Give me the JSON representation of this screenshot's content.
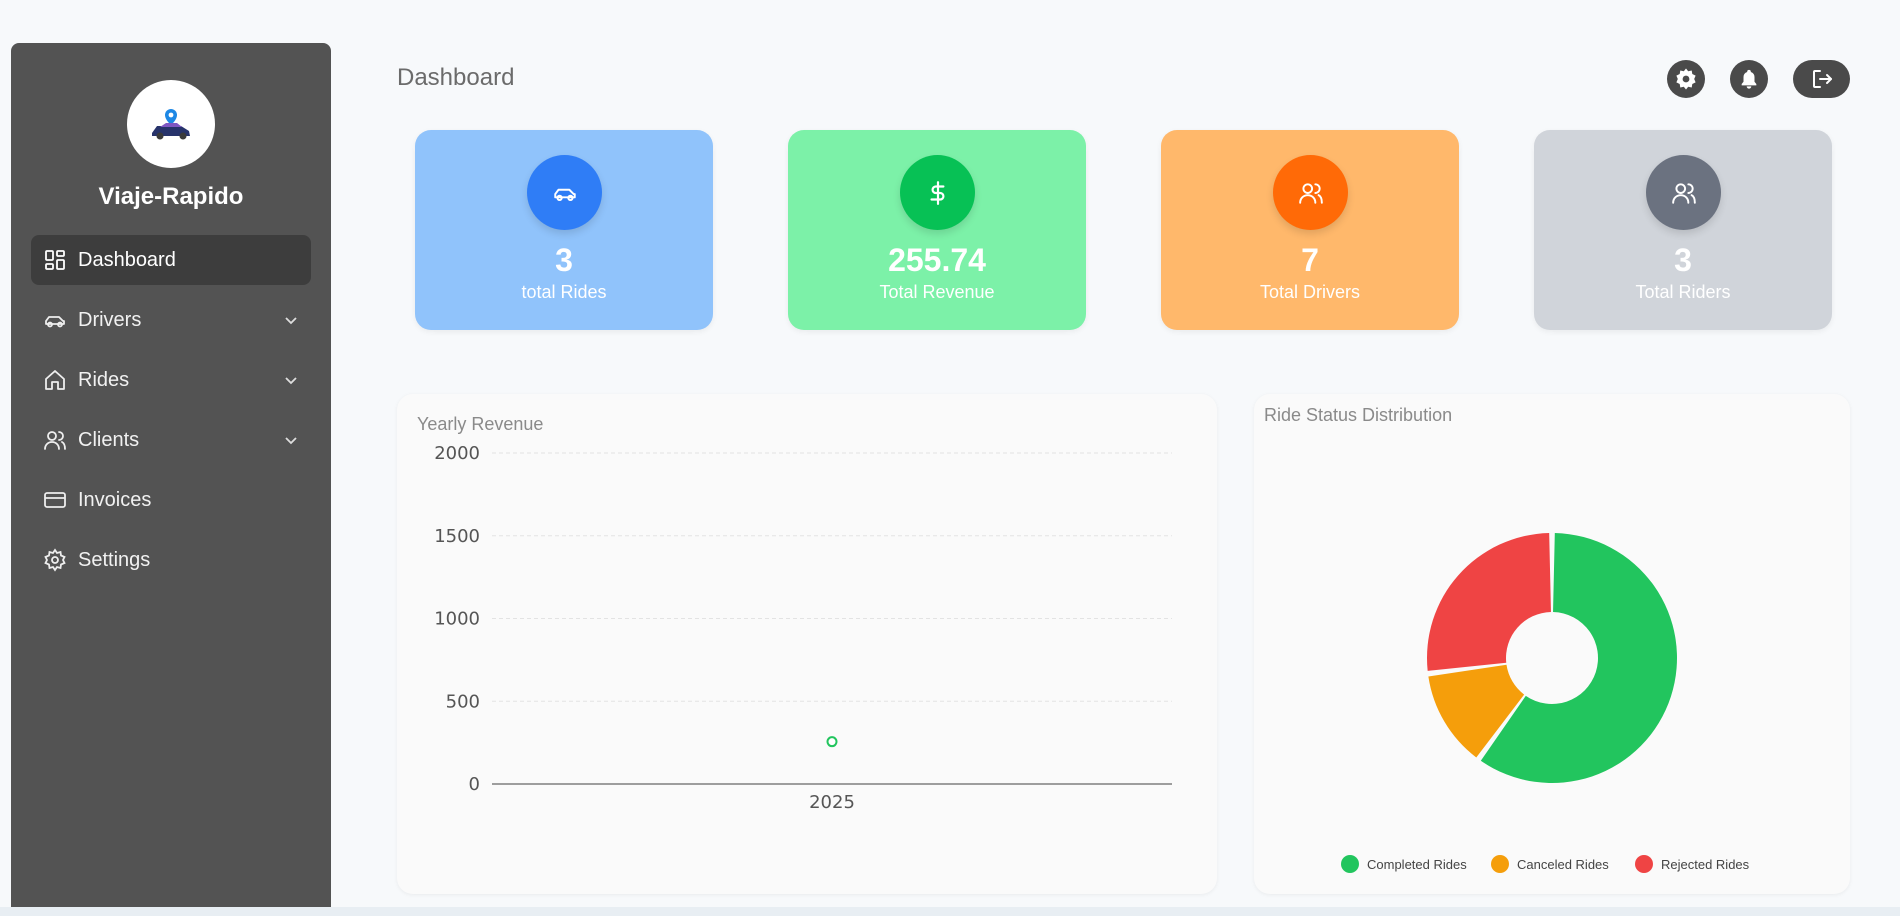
{
  "brand": {
    "name": "Viaje-Rapido"
  },
  "sidebar": {
    "items": [
      {
        "label": "Dashboard",
        "icon": "dashboard-icon",
        "active": true
      },
      {
        "label": "Drivers",
        "icon": "car-icon",
        "has_submenu": true
      },
      {
        "label": "Rides",
        "icon": "home-icon",
        "has_submenu": true
      },
      {
        "label": "Clients",
        "icon": "users-icon",
        "has_submenu": true
      },
      {
        "label": "Invoices",
        "icon": "card-icon"
      },
      {
        "label": "Settings",
        "icon": "gear-icon"
      }
    ]
  },
  "header": {
    "title": "Dashboard",
    "actions": [
      "gear-icon",
      "bell-icon",
      "logout-icon"
    ]
  },
  "stats": [
    {
      "value": "3",
      "label": "total Rides",
      "icon": "car-icon",
      "bg": "#90c3fb",
      "icon_bg": "#2f7df6"
    },
    {
      "value": "255.74",
      "label": "Total Revenue",
      "icon": "dollar-icon",
      "bg": "#7cf1a8",
      "icon_bg": "#07c155"
    },
    {
      "value": "7",
      "label": "Total Drivers",
      "icon": "users-icon",
      "bg": "#ffb86b",
      "icon_bg": "#ff6a07"
    },
    {
      "value": "3",
      "label": "Total Riders",
      "icon": "users-icon",
      "bg": "#d0d4da",
      "icon_bg": "#6b7280"
    }
  ],
  "chart_data": [
    {
      "type": "scatter",
      "title": "Yearly Revenue",
      "categories": [
        "2025"
      ],
      "values": [
        255.74
      ],
      "ylim": [
        0,
        2000
      ],
      "yticks": [
        "0",
        "500",
        "1000",
        "1500",
        "2000"
      ],
      "grid": true,
      "color": "#22c55e"
    },
    {
      "type": "pie",
      "title": "Ride Status Distribution",
      "labels": [
        "Completed Rides",
        "Canceled Rides",
        "Rejected Rides"
      ],
      "values": [
        60,
        13,
        27
      ],
      "colors": [
        "#22c55e",
        "#f59e0b",
        "#ef4444"
      ],
      "legend": "bottom"
    }
  ]
}
